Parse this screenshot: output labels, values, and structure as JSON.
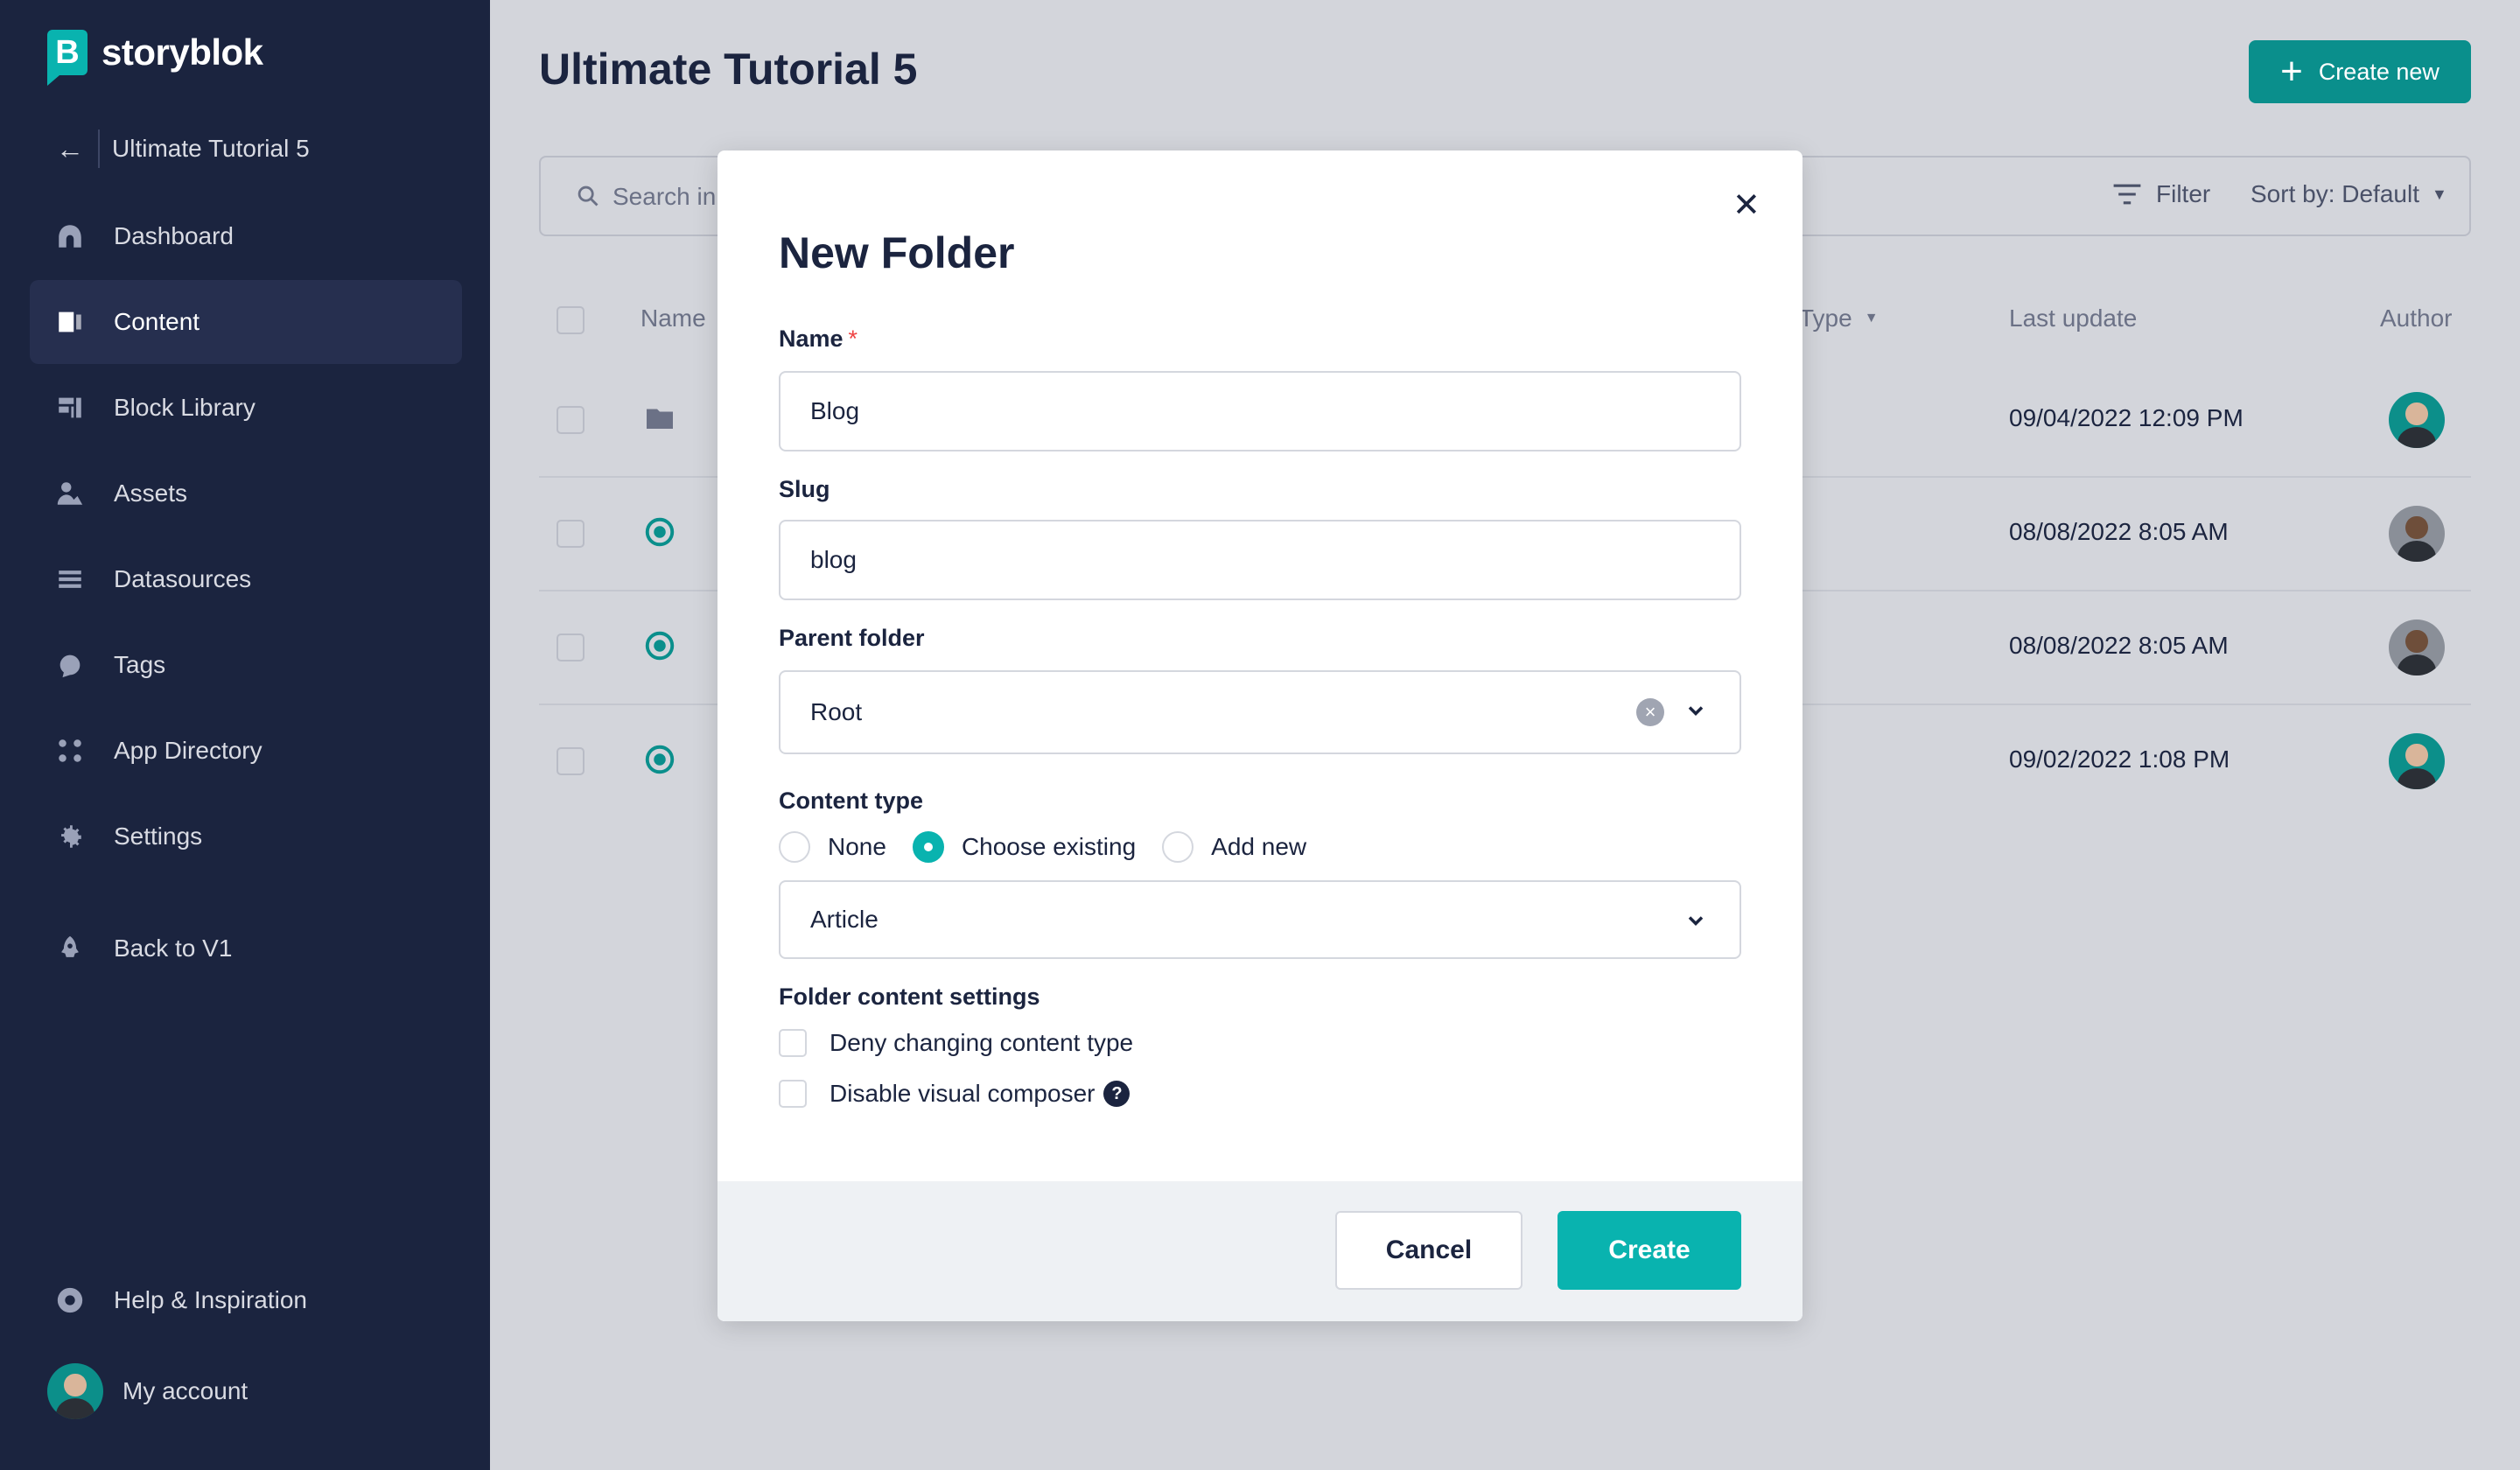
{
  "brand": {
    "name": "storyblok",
    "logo_letter": "B",
    "accent": "#09b3af",
    "sidebar_bg": "#1b243f"
  },
  "sidebar": {
    "space_name": "Ultimate Tutorial 5",
    "items": [
      {
        "label": "Dashboard",
        "icon": "dashboard-icon"
      },
      {
        "label": "Content",
        "icon": "content-icon",
        "active": true
      },
      {
        "label": "Block Library",
        "icon": "block-library-icon"
      },
      {
        "label": "Assets",
        "icon": "assets-icon"
      },
      {
        "label": "Datasources",
        "icon": "datasources-icon"
      },
      {
        "label": "Tags",
        "icon": "tags-icon"
      },
      {
        "label": "App Directory",
        "icon": "app-directory-icon"
      },
      {
        "label": "Settings",
        "icon": "gear-icon"
      }
    ],
    "back_to_v1": "Back to V1",
    "help": "Help & Inspiration",
    "account": "My account"
  },
  "main": {
    "title": "Ultimate Tutorial 5",
    "create_new": "Create new",
    "search_placeholder": "Search in",
    "filter": "Filter",
    "sort": "Sort by: Default",
    "columns": {
      "name": "Name",
      "type": "Type",
      "last_update": "Last update",
      "author": "Author"
    },
    "rows": [
      {
        "kind": "folder",
        "updated": "09/04/2022 12:09 PM",
        "author_avatar": "teal"
      },
      {
        "kind": "story",
        "updated": "08/08/2022 8:05 AM",
        "author_avatar": "gray"
      },
      {
        "kind": "story",
        "updated": "08/08/2022 8:05 AM",
        "author_avatar": "gray"
      },
      {
        "kind": "story",
        "updated": "09/02/2022 1:08 PM",
        "author_avatar": "teal"
      }
    ]
  },
  "modal": {
    "title": "New Folder",
    "name_label": "Name",
    "required_mark": "*",
    "name_value": "Blog",
    "slug_label": "Slug",
    "slug_value": "blog",
    "parent_label": "Parent folder",
    "parent_value": "Root",
    "content_type_label": "Content type",
    "content_type_options": [
      "None",
      "Choose existing",
      "Add new"
    ],
    "content_type_selected": "Choose existing",
    "content_type_value": "Article",
    "settings_label": "Folder content settings",
    "deny_change": "Deny changing content type",
    "disable_composer": "Disable visual composer",
    "cancel": "Cancel",
    "create": "Create"
  }
}
